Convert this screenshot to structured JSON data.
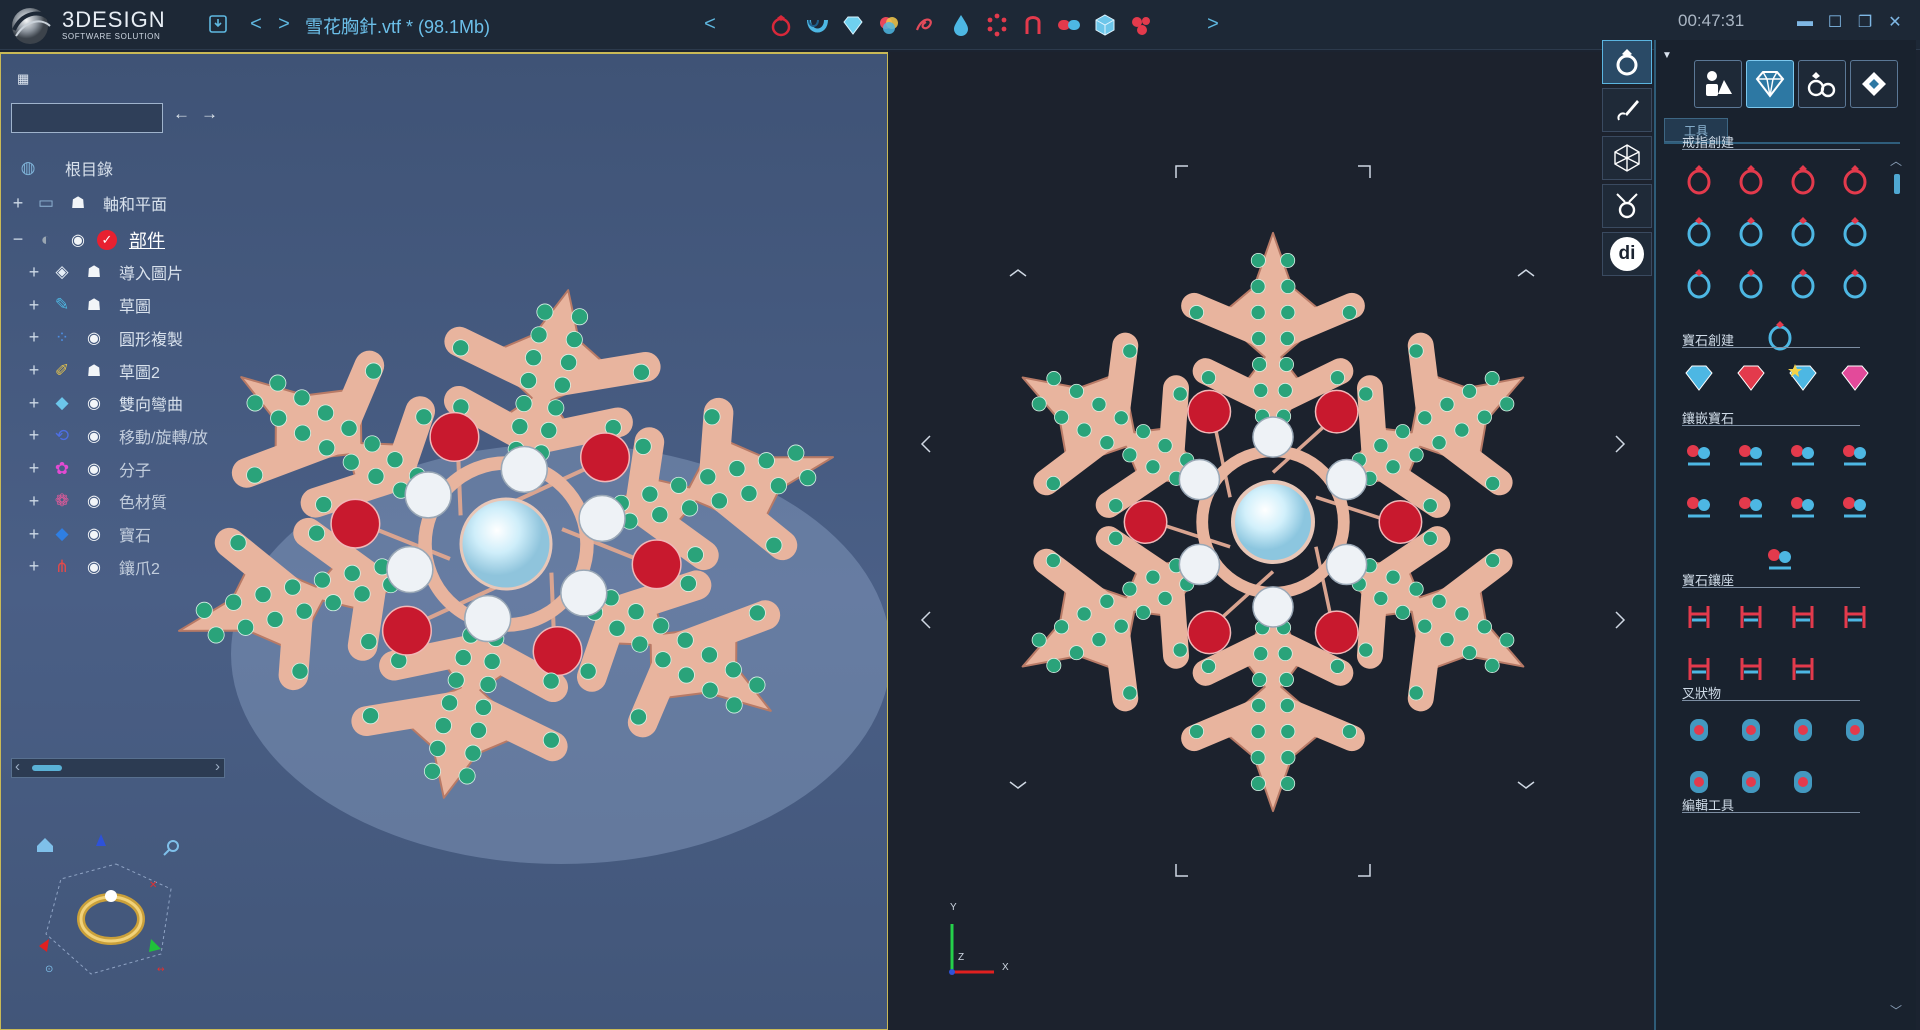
{
  "app": {
    "brand": "3DESIGN",
    "brand_sub": "SOFTWARE SOLUTION",
    "file_title": "雪花胸針.vtf * (98.1Mb)",
    "clock": "00:47:31"
  },
  "topbar": {
    "save_icon": "save-icon",
    "nav_prev": "<",
    "nav_next": ">",
    "tools_prev": "<",
    "tools_next": ">",
    "quick_tools": [
      "ring-icon",
      "bend-icon",
      "gem-icon",
      "color-mix-icon",
      "spiral-icon",
      "drop-icon",
      "circle-pattern-icon",
      "prong-icon",
      "link-icon",
      "cube-icon",
      "gem-cluster-icon"
    ],
    "window_controls": [
      "minimize-icon",
      "maximize-icon",
      "restore-icon",
      "close-icon"
    ]
  },
  "tree": {
    "search_value": "",
    "back": "←",
    "forward": "→",
    "root_label": "根目錄",
    "items": [
      {
        "label": "軸和平面",
        "icon": "folder-icon",
        "visibility": "ghost-icon",
        "expander": "+"
      },
      {
        "label": "部件",
        "icon": "parts-icon",
        "visibility": "eye-icon",
        "expander": "−",
        "checked": true
      },
      {
        "label": "導入圖片",
        "icon": "import-image-icon",
        "visibility": "ghost-icon",
        "expander": "+"
      },
      {
        "label": "草圖",
        "icon": "sketch-icon",
        "visibility": "ghost-icon",
        "expander": "+"
      },
      {
        "label": "圓形複製",
        "icon": "circular-copy-icon",
        "visibility": "eye-icon",
        "expander": "+"
      },
      {
        "label": "草圖2",
        "icon": "sketch2-icon",
        "visibility": "ghost-icon",
        "expander": "+"
      },
      {
        "label": "雙向彎曲",
        "icon": "double-bend-icon",
        "visibility": "eye-icon",
        "expander": "+"
      },
      {
        "label": "移動/旋轉/放",
        "icon": "move-rotate-icon",
        "visibility": "eye-icon",
        "expander": "+"
      },
      {
        "label": "分子",
        "icon": "molecule-icon",
        "visibility": "eye-icon",
        "expander": "+"
      },
      {
        "label": "色材質",
        "icon": "material-icon",
        "visibility": "eye-icon",
        "expander": "+"
      },
      {
        "label": "寶石",
        "icon": "gem-blue-icon",
        "visibility": "eye-icon",
        "expander": "+"
      },
      {
        "label": "鑲爪2",
        "icon": "prong2-icon",
        "visibility": "eye-icon",
        "expander": "+"
      }
    ]
  },
  "viewport_right": {
    "axis_y": "Y",
    "axis_x": "X",
    "axis_z": "Z"
  },
  "mode_strip": [
    "ring-mode-icon",
    "pen-mode-icon",
    "mesh-mode-icon",
    "render-mode-icon",
    "di-mode-icon"
  ],
  "mode_di_label": "di",
  "tool_panel": {
    "categories": [
      "shapes-category-icon",
      "gem-category-icon",
      "rings-category-icon",
      "settings-category-icon"
    ],
    "tab_label": "工具",
    "sections": [
      {
        "title": "戒指創建",
        "tools": [
          "ring-create-icon",
          "ring-dotted-icon",
          "ring-top-icon",
          "ring-pair-icon",
          "ring-twist-icon",
          "ring-oval-icon",
          "ring-band-icon",
          "ring-loop-icon",
          "ring-eternity-icon",
          "ring-gauge-icon",
          "ring-bypass-icon",
          "ring-halo-icon",
          "ring-side-icon"
        ]
      },
      {
        "title": "寶石創建",
        "tools": [
          "gem-diamond-icon",
          "gem-red-icon",
          "gem-star-icon",
          "gem-multi-icon"
        ]
      },
      {
        "title": "鑲嵌寶石",
        "tools": [
          "set-cluster-icon",
          "set-on-surface-icon",
          "set-down-icon",
          "set-rail-icon",
          "set-channel-icon",
          "set-curve-icon",
          "set-flower-icon",
          "set-grid-icon",
          "set-bowl-icon"
        ]
      },
      {
        "title": "寶石鑲座",
        "tools": [
          "bezel-prong-icon",
          "bezel-double-icon",
          "bezel-cup-icon",
          "bezel-side-icon",
          "bezel-trio-icon",
          "bezel-arc-icon",
          "bezel-oval-icon"
        ]
      },
      {
        "title": "叉狀物",
        "tools": [
          "prong-cylinder-icon",
          "prong-scatter-icon",
          "prong-cluster-icon",
          "prong-gem-icon",
          "prong-cross-icon",
          "prong-ring-icon",
          "prong-oval-icon"
        ]
      },
      {
        "title": "編輯工具",
        "tools": [
          "edit-measure-icon",
          "edit-curve-icon",
          "edit-dots-icon",
          "edit-spike-icon"
        ]
      }
    ]
  },
  "colors": {
    "accent": "#5bb5e0",
    "viewport_left_bg": "#4a5f86",
    "viewport_right_bg": "#1c222d",
    "metal": "#e8b49e",
    "emerald": "#2aa37a",
    "ruby": "#c8192e",
    "diamond": "#eef2f6"
  }
}
